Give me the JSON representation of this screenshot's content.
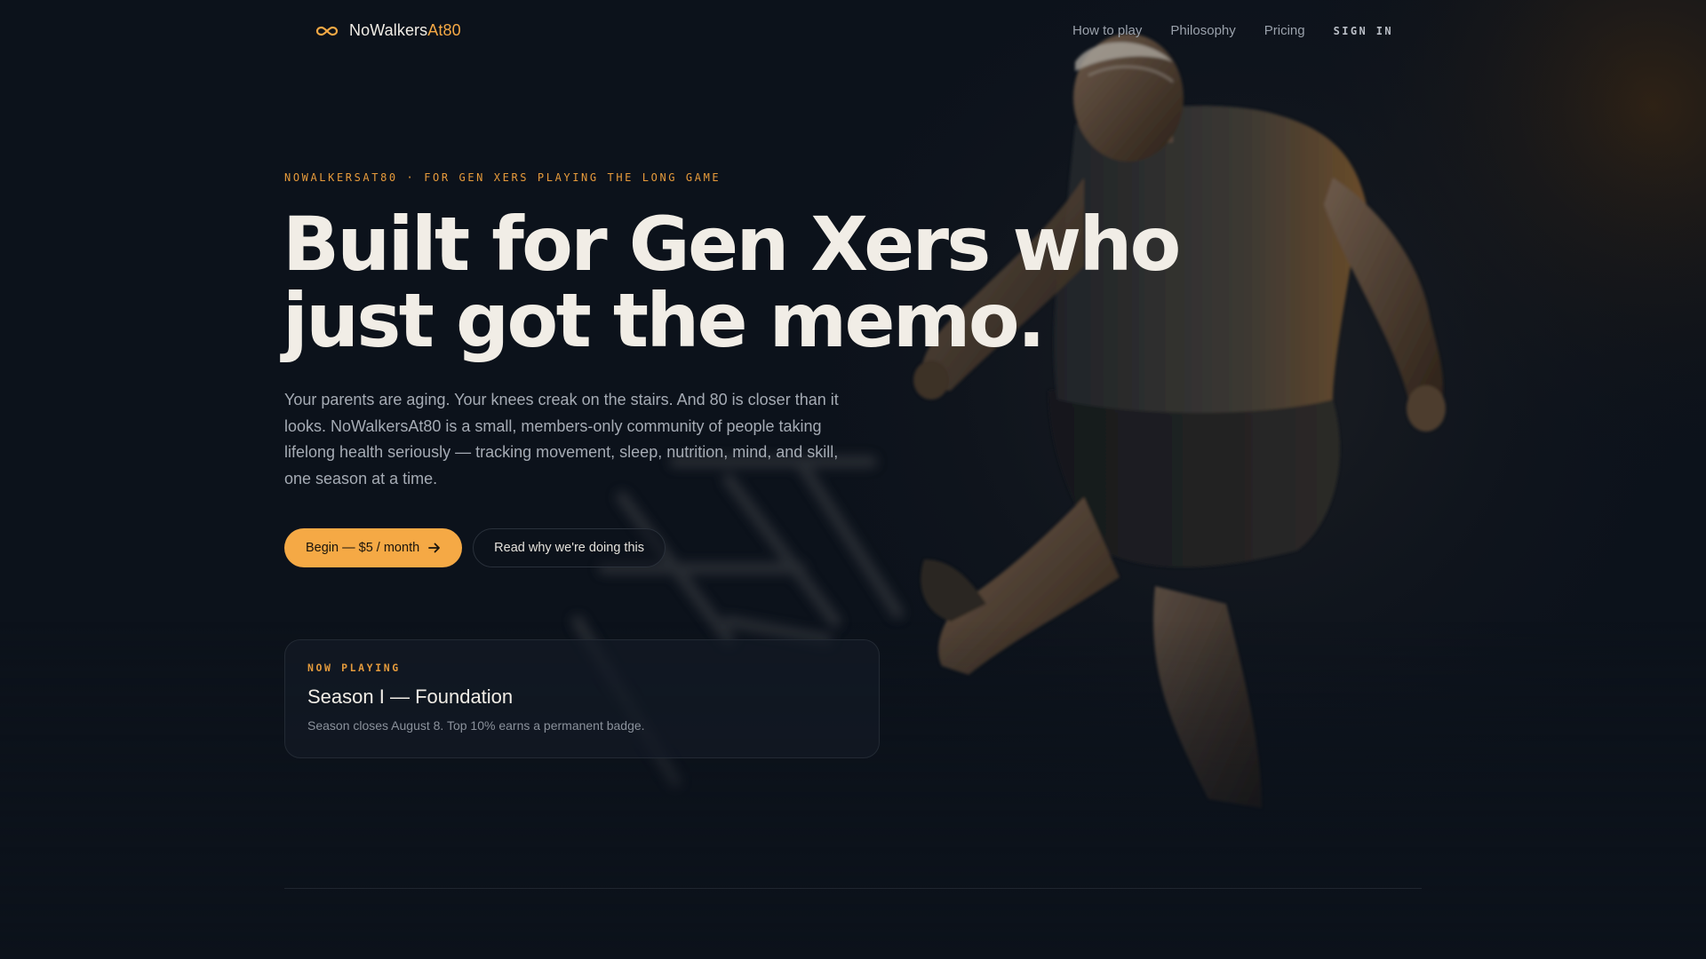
{
  "nav": {
    "brand_name": "NoWalkers",
    "brand_accent": "At80",
    "brand_icon": "infinity-icon",
    "links": [
      {
        "label": "How to play"
      },
      {
        "label": "Philosophy"
      },
      {
        "label": "Pricing"
      }
    ],
    "signin_label": "SIGN IN"
  },
  "hero": {
    "eyebrow": "NOWALKERSAT80 · FOR GEN XERS PLAYING THE LONG GAME",
    "headline_line1": "Built for Gen Xers who",
    "headline_line2": "just got the memo.",
    "lede": "Your parents are aging. Your knees creak on the stairs. And 80 is closer than it looks. NoWalkersAt80 is a small, members-only community of people taking lifelong health seriously — tracking movement, sleep, nutrition, mind, and skill, one season at a time.",
    "cta_primary": "Begin — $5 / month",
    "cta_primary_icon": "arrow-right-icon",
    "cta_secondary": "Read why we're doing this"
  },
  "season": {
    "eyebrow": "NOW PLAYING",
    "title": "Season I — Foundation",
    "subtitle": "Season closes August 8. Top 10% earns a permanent badge."
  },
  "colors": {
    "background": "#0c121b",
    "accent": "#f5a945",
    "text": "#f1ede6",
    "muted": "#a5abb4"
  }
}
